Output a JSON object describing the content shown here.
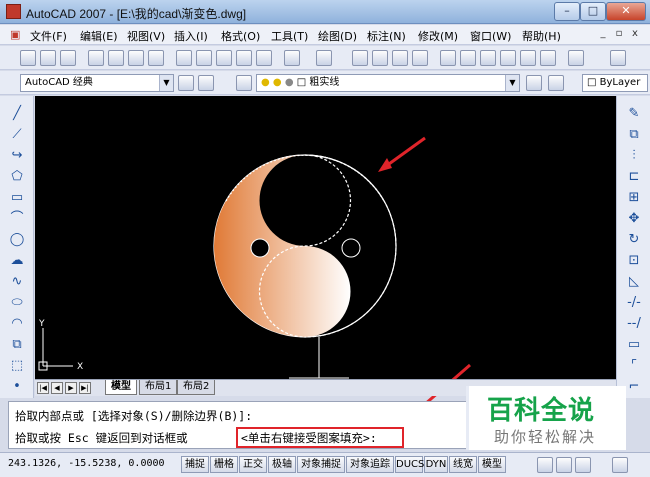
{
  "window": {
    "title": "AutoCAD 2007 - [E:\\我的cad\\渐变色.dwg]",
    "minimize": "–",
    "maximize": "□",
    "close": "✕"
  },
  "menubar": {
    "items": [
      "文件(F)",
      "编辑(E)",
      "视图(V)",
      "插入(I)",
      "格式(O)",
      "工具(T)",
      "绘图(D)",
      "标注(N)",
      "修改(M)",
      "窗口(W)",
      "帮助(H)"
    ],
    "mdi_min": "_",
    "mdi_restore": "▫",
    "mdi_close": "x"
  },
  "toolbar2": {
    "workspace": "AutoCAD 经典",
    "layer": "粗实线",
    "bylayer": "ByLayer"
  },
  "drawing": {
    "ucs_x": "X",
    "ucs_y": "Y"
  },
  "tabs": {
    "items": [
      "模型",
      "布局1",
      "布局2"
    ],
    "active": "模型"
  },
  "command": {
    "line1": "拾取内部点或 [选择对象(S)/删除边界(B)]:",
    "line2_prefix": "拾取或按 Esc 键返回到对话框或",
    "line2_highlight": "<单击右键接受图案填充>:"
  },
  "status": {
    "coords": "243.1326, -15.5238, 0.0000",
    "buttons": [
      "捕捉",
      "栅格",
      "正交",
      "极轴",
      "对象捕捉",
      "对象追踪",
      "DUCS",
      "DYN",
      "线宽",
      "模型"
    ]
  },
  "watermark": {
    "title": "百科全说",
    "subtitle": "助你轻松解决"
  },
  "colors": {
    "highlight": "#e0242a",
    "gradient_start": "#e07a36",
    "watermark": "#16a34a"
  }
}
